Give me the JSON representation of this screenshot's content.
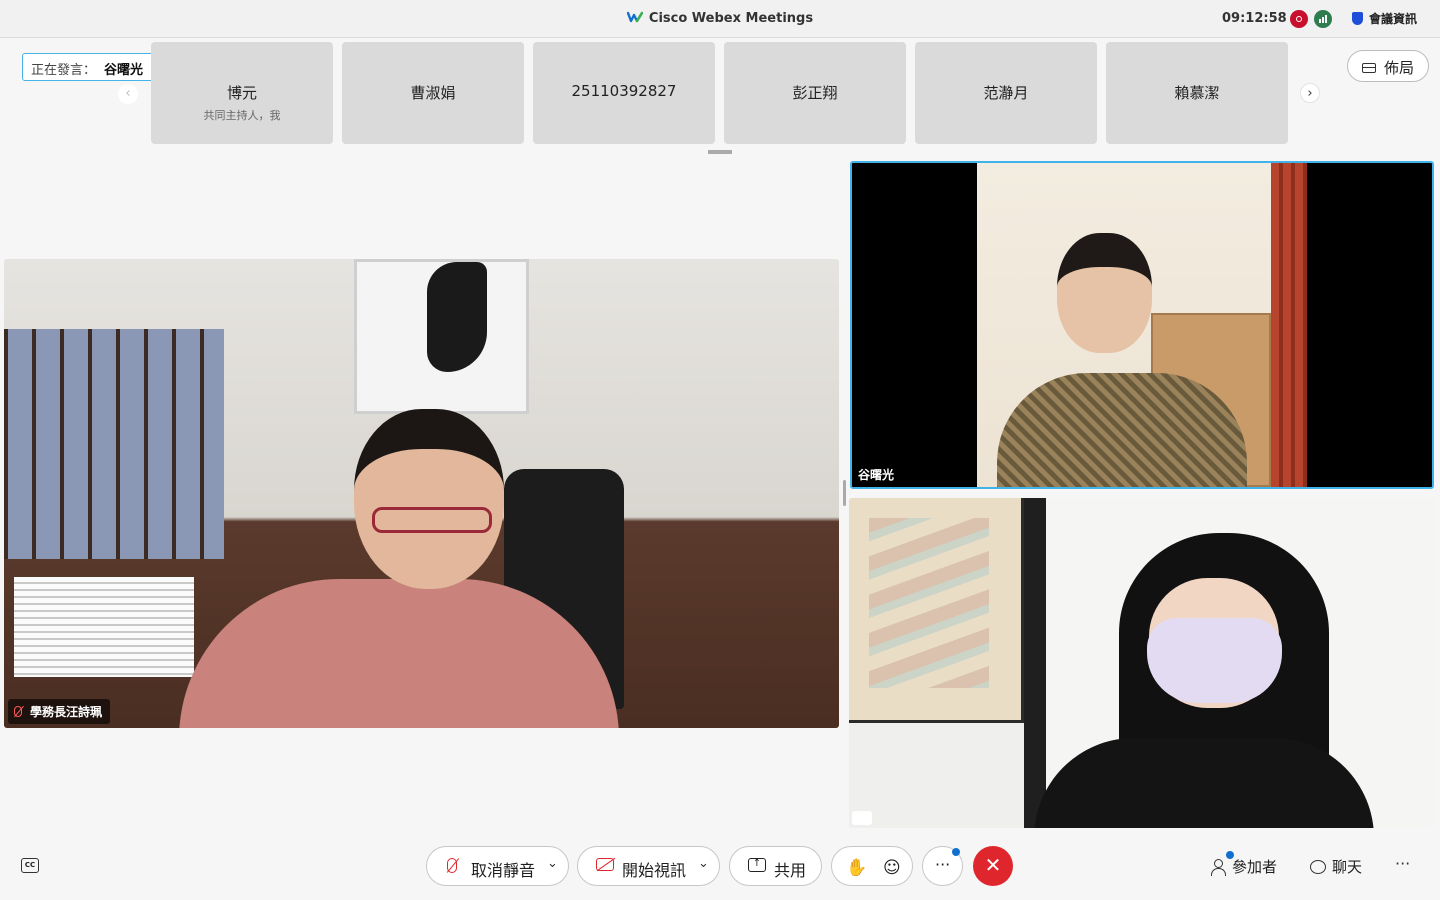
{
  "titlebar": {
    "app_title": "Cisco Webex Meetings",
    "clock": "09:12:58",
    "meeting_info_label": "會議資訊"
  },
  "filmstrip": {
    "speaking_label": "正在發言：",
    "speaking_name": "谷曙光",
    "left_arrow": "‹",
    "right_arrow": "›",
    "participants": [
      {
        "name": "博元",
        "subtitle": "共同主持人，我"
      },
      {
        "name": "曹淑娟",
        "subtitle": ""
      },
      {
        "name": "25110392827",
        "subtitle": ""
      },
      {
        "name": "彭正翔",
        "subtitle": ""
      },
      {
        "name": "范瀞月",
        "subtitle": ""
      },
      {
        "name": "賴慕潔",
        "subtitle": ""
      }
    ]
  },
  "layout_button": {
    "label": "佈局"
  },
  "videos": {
    "main": {
      "name": "學務長汪詩珮",
      "muted": true
    },
    "top_right": {
      "name": "谷曙光",
      "active_speaker": true
    },
    "bottom_right": {
      "name": ""
    }
  },
  "toolbar": {
    "captions_label": "CC",
    "unmute_label": "取消靜音",
    "start_video_label": "開始視訊",
    "share_label": "共用",
    "more_label": "···",
    "end_label": "✕",
    "participants_label": "參加者",
    "chat_label": "聊天",
    "overflow_label": "···"
  },
  "icons": {
    "record": "record-icon",
    "network": "network-icon",
    "shield": "shield-icon",
    "hand": "raise-hand-icon",
    "reactions": "reactions-icon"
  },
  "colors": {
    "active_speaker_border": "#40b3ea",
    "end_button": "#e0262d",
    "muted_icon": "#e0262d"
  }
}
